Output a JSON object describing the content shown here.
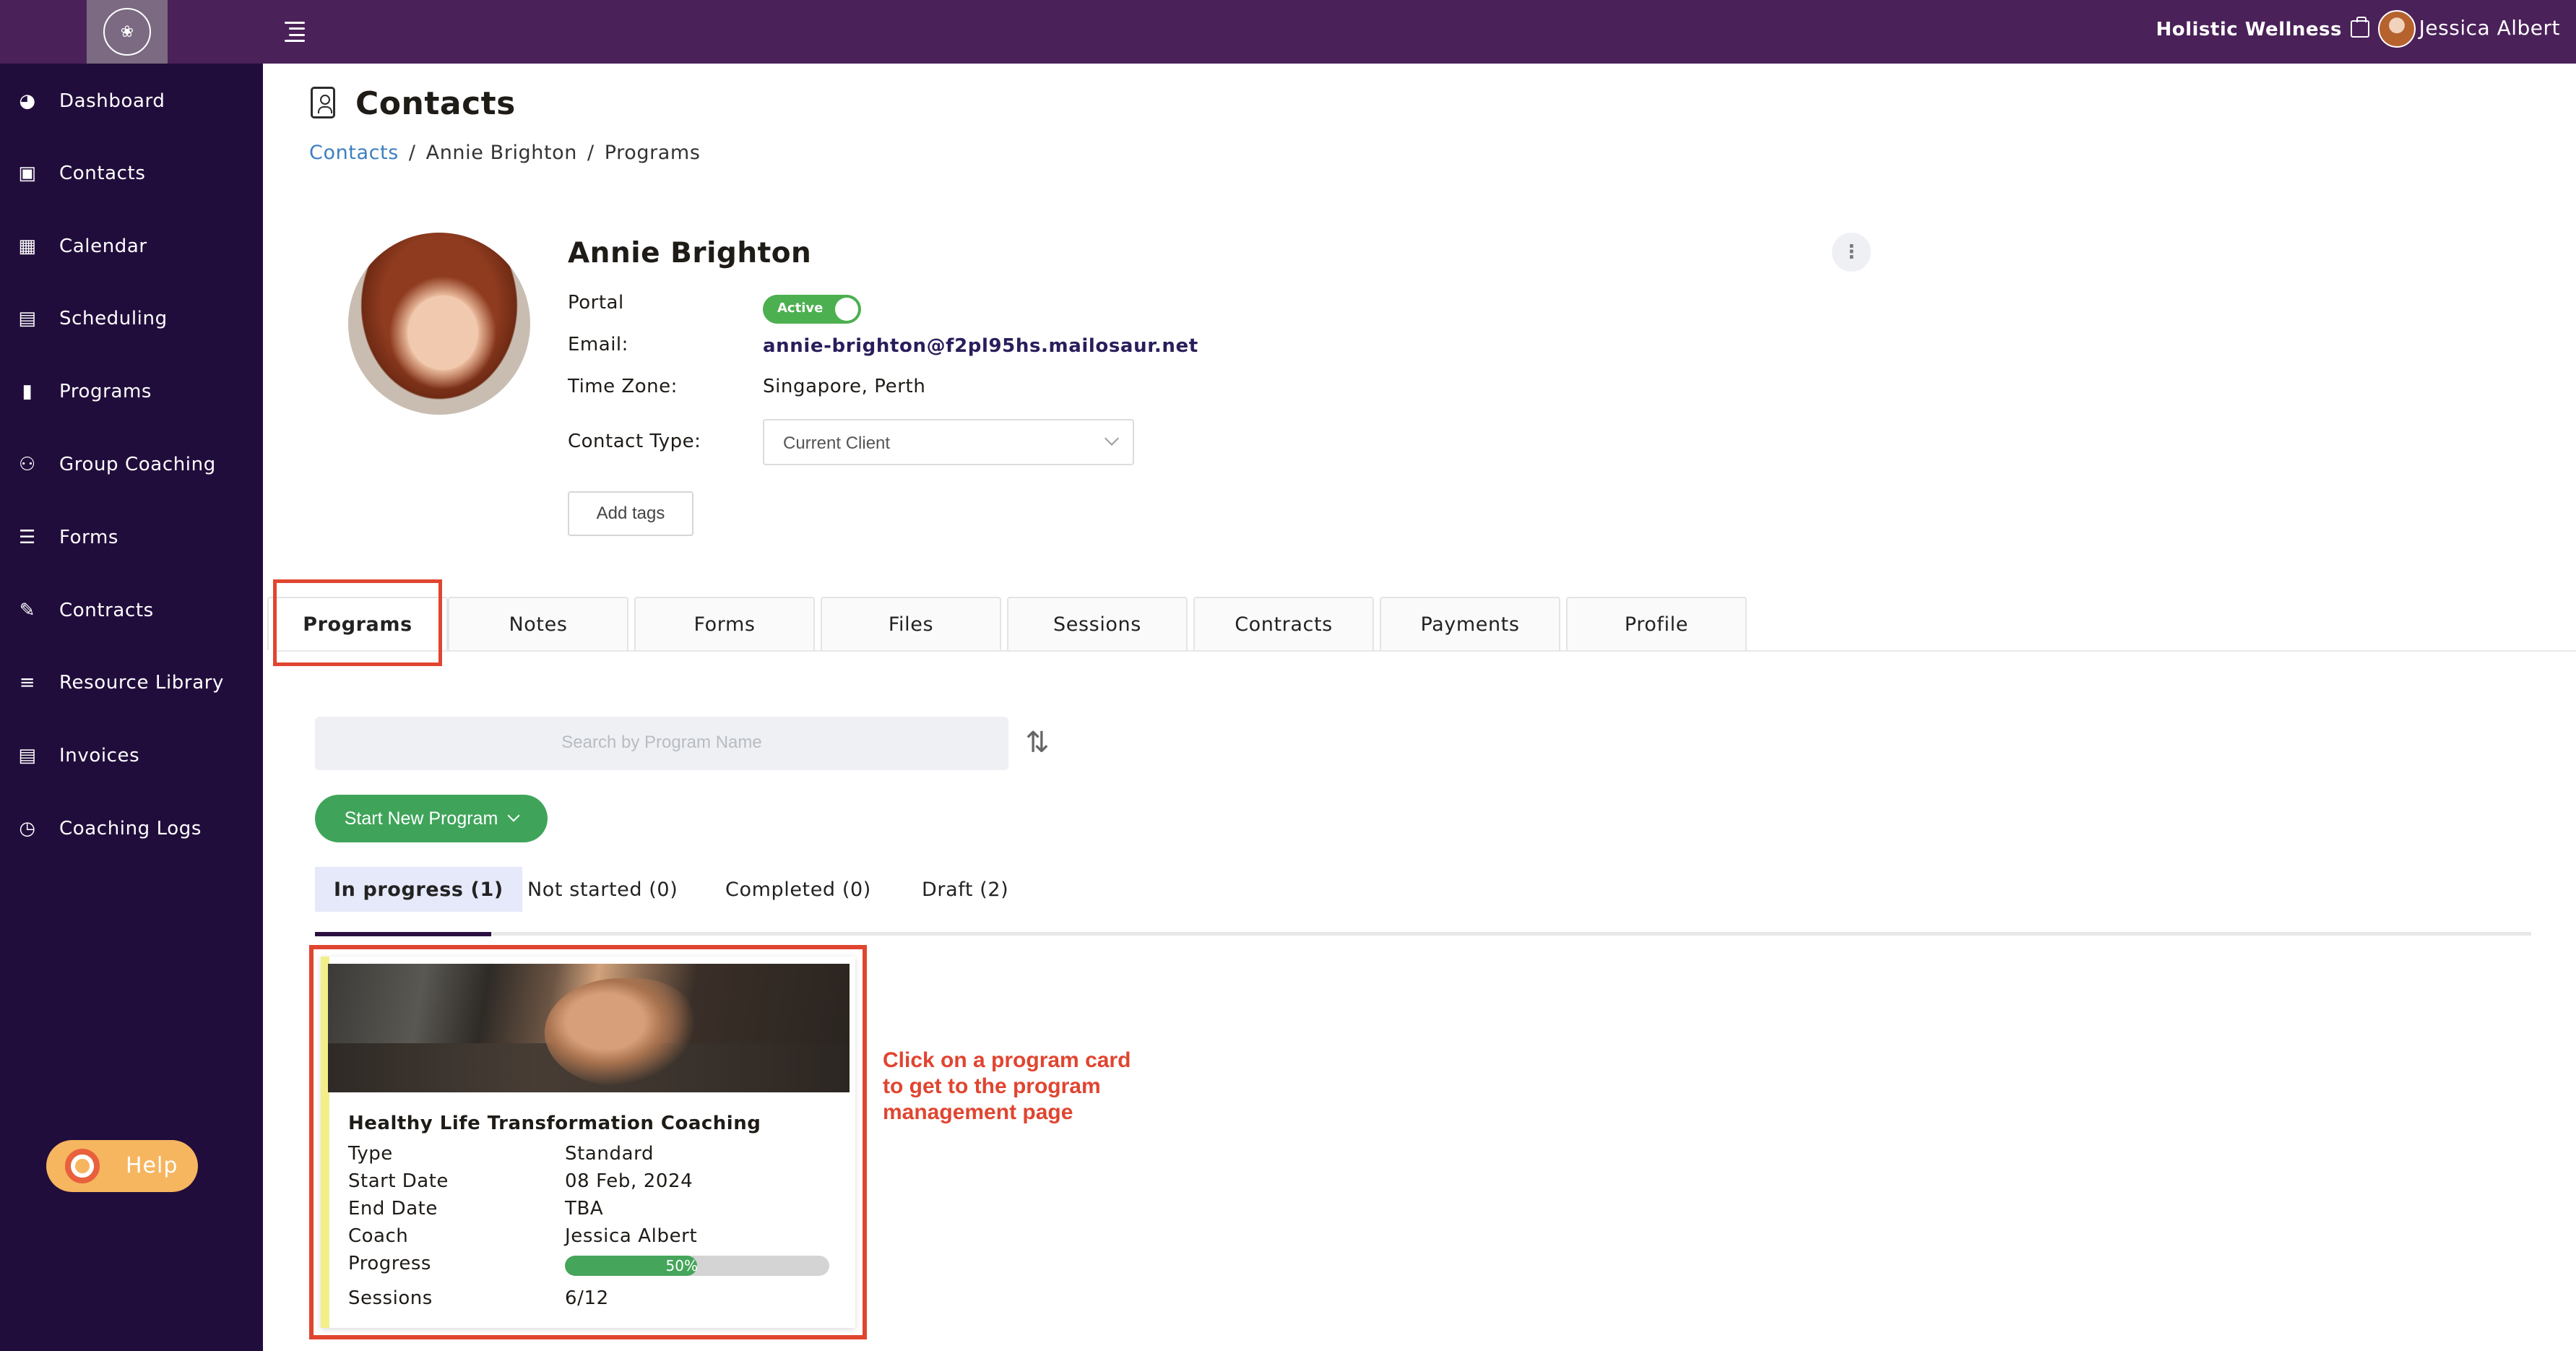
{
  "header": {
    "org_name": "Holistic Wellness",
    "user_name": "Jessica Albert"
  },
  "sidebar": {
    "items": [
      {
        "label": "Dashboard",
        "icon": "dashboard-icon"
      },
      {
        "label": "Contacts",
        "icon": "contacts-icon"
      },
      {
        "label": "Calendar",
        "icon": "calendar-icon"
      },
      {
        "label": "Scheduling",
        "icon": "scheduling-icon"
      },
      {
        "label": "Programs",
        "icon": "programs-icon"
      },
      {
        "label": "Group Coaching",
        "icon": "group-coaching-icon"
      },
      {
        "label": "Forms",
        "icon": "forms-icon"
      },
      {
        "label": "Contracts",
        "icon": "contracts-icon"
      },
      {
        "label": "Resource Library",
        "icon": "resource-library-icon"
      },
      {
        "label": "Invoices",
        "icon": "invoices-icon"
      },
      {
        "label": "Coaching Logs",
        "icon": "coaching-logs-icon"
      }
    ],
    "help_label": "Help"
  },
  "page": {
    "title": "Contacts",
    "breadcrumb": [
      "Contacts",
      "Annie Brighton",
      "Programs"
    ]
  },
  "contact": {
    "name": "Annie Brighton",
    "portal_label": "Portal",
    "portal_status": "Active",
    "email_label": "Email:",
    "email": "annie-brighton@f2pl95hs.mailosaur.net",
    "timezone_label": "Time Zone:",
    "timezone": "Singapore, Perth",
    "contact_type_label": "Contact Type:",
    "contact_type": "Current Client",
    "add_tags_label": "Add tags"
  },
  "tabs": [
    "Programs",
    "Notes",
    "Forms",
    "Files",
    "Sessions",
    "Contracts",
    "Payments",
    "Profile"
  ],
  "programs": {
    "search_placeholder": "Search by Program Name",
    "start_button": "Start New Program",
    "subtabs": [
      "In progress (1)",
      "Not started (0)",
      "Completed (0)",
      "Draft (2)"
    ],
    "card": {
      "title": "Healthy Life Transformation Coaching",
      "type_label": "Type",
      "type": "Standard",
      "start_label": "Start Date",
      "start": "08 Feb, 2024",
      "end_label": "End Date",
      "end": "TBA",
      "coach_label": "Coach",
      "coach": "Jessica Albert",
      "progress_label": "Progress",
      "progress": 0.5,
      "progress_text": "50%",
      "sessions_label": "Sessions",
      "sessions": "6/12"
    }
  },
  "annotation": "Click on a program card to get to the program management page",
  "colors": {
    "topbar": "#4a2159",
    "sidebar": "#210d3c",
    "accent_green": "#3fa45a",
    "highlight_red": "#e04530"
  }
}
